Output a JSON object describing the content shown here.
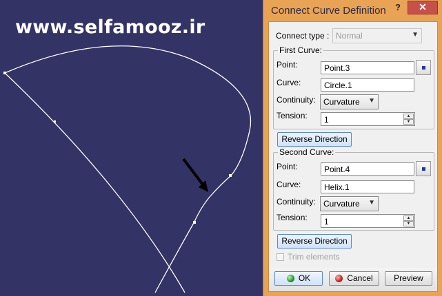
{
  "watermark": "www.selfamooz.ir",
  "dialog": {
    "title": "Connect Curve Definition",
    "help_label": "?",
    "close_label": "✕",
    "connect_type": {
      "label": "Connect type :",
      "value": "Normal"
    },
    "first_curve": {
      "title": "First Curve:",
      "point_label": "Point:",
      "point_value": "Point.3",
      "curve_label": "Curve:",
      "curve_value": "Circle.1",
      "continuity_label": "Continuity:",
      "continuity_value": "Curvature",
      "tension_label": "Tension:",
      "tension_value": "1"
    },
    "reverse_label_1": "Reverse Direction",
    "second_curve": {
      "title": "Second Curve:",
      "point_label": "Point:",
      "point_value": "Point.4",
      "curve_label": "Curve:",
      "curve_value": "Helix.1",
      "continuity_label": "Continuity:",
      "continuity_value": "Curvature",
      "tension_label": "Tension:",
      "tension_value": "1"
    },
    "reverse_label_2": "Reverse Direction",
    "trim_label": "Trim elements",
    "ok_label": "OK",
    "cancel_label": "Cancel",
    "preview_label": "Preview"
  },
  "colors": {
    "viewport_bg": "#333366",
    "curve": "#ffffff",
    "titlebar": "#e9a355",
    "close": "#c7504a"
  },
  "icons": {
    "select": "select-point-icon",
    "ok": "green-ball-icon",
    "cancel": "red-ball-icon",
    "arrow": "pointer-arrow"
  }
}
